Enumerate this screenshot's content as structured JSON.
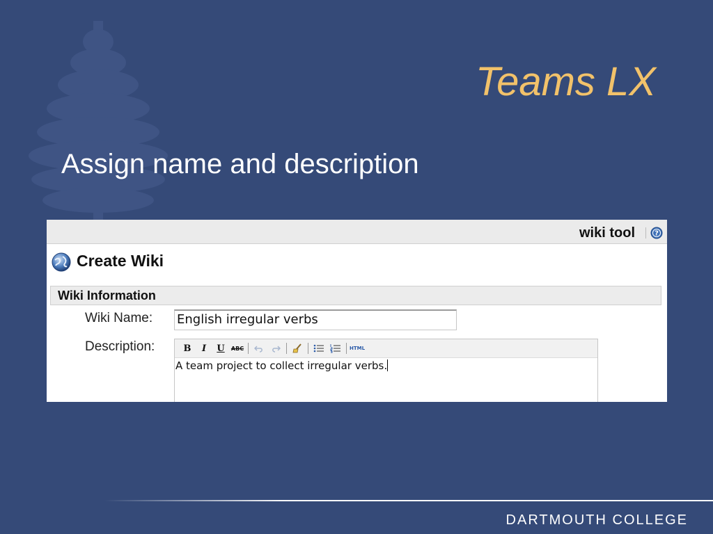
{
  "slide": {
    "title": "Teams LX",
    "bullet": "Assign name and description",
    "footer": "DARTMOUTH COLLEGE",
    "colors": {
      "background": "#354a78",
      "title": "#f2c26a",
      "text": "#ffffff"
    }
  },
  "screenshot": {
    "tool_name": "wiki tool",
    "page_title": "Create Wiki",
    "section_title": "Wiki Information",
    "fields": {
      "name_label": "Wiki Name:",
      "name_value": "English irregular verbs",
      "description_label": "Description:",
      "description_value": "A team project to collect irregular verbs."
    },
    "editor_toolbar": {
      "bold": "B",
      "italic": "I",
      "underline": "U",
      "strikethrough": "ABC",
      "html": "HTML"
    },
    "icons": [
      "help-icon",
      "globe-icon",
      "undo-icon",
      "redo-icon",
      "clean-icon",
      "bullet-list-icon",
      "numbered-list-icon"
    ]
  }
}
